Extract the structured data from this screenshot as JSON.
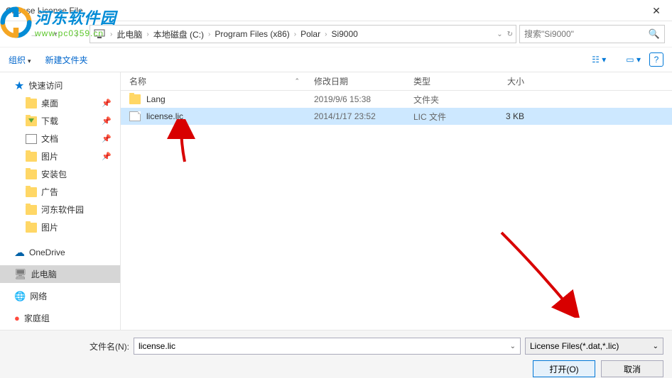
{
  "title": "Choose License File",
  "watermark": {
    "main": "河东软件园",
    "url": "www.pc0359.cn"
  },
  "breadcrumb": {
    "root": "此电脑",
    "path": [
      "本地磁盘 (C:)",
      "Program Files (x86)",
      "Polar",
      "Si9000"
    ]
  },
  "search": {
    "placeholder": "搜索\"Si9000\""
  },
  "toolbar": {
    "organize": "组织",
    "newfolder": "新建文件夹"
  },
  "columns": {
    "name": "名称",
    "date": "修改日期",
    "type": "类型",
    "size": "大小"
  },
  "sidebar": {
    "quick": "快速访问",
    "items": [
      {
        "label": "桌面",
        "pin": true
      },
      {
        "label": "下载",
        "pin": true
      },
      {
        "label": "文档",
        "pin": true
      },
      {
        "label": "图片",
        "pin": true
      },
      {
        "label": "安装包",
        "pin": false
      },
      {
        "label": "广告",
        "pin": false
      },
      {
        "label": "河东软件园",
        "pin": false
      },
      {
        "label": "图片",
        "pin": false
      }
    ],
    "onedrive": "OneDrive",
    "pc": "此电脑",
    "network": "网络",
    "homegroup": "家庭组"
  },
  "files": [
    {
      "name": "Lang",
      "date": "2019/9/6 15:38",
      "type": "文件夹",
      "size": "",
      "folder": true,
      "sel": false
    },
    {
      "name": "license.lic",
      "date": "2014/1/17 23:52",
      "type": "LIC 文件",
      "size": "3 KB",
      "folder": false,
      "sel": true
    }
  ],
  "footer": {
    "filename_label": "文件名(N):",
    "filename_value": "license.lic",
    "filter": "License Files(*.dat,*.lic)",
    "open": "打开(O)",
    "cancel": "取消"
  }
}
